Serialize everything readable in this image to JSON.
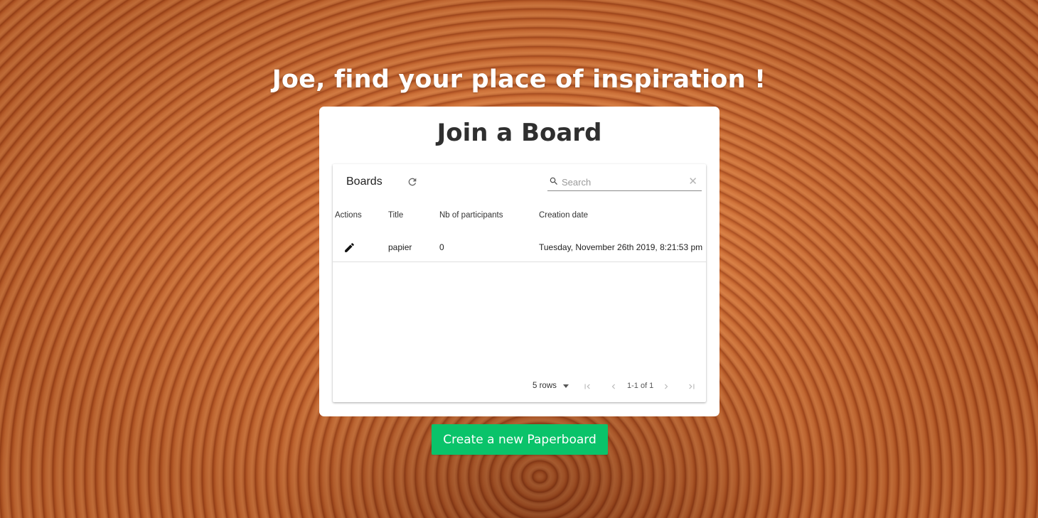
{
  "headline": "Joe, find your place of inspiration !",
  "card": {
    "title": "Join a Board"
  },
  "table": {
    "toolbar_title": "Boards",
    "search_placeholder": "Search",
    "columns": [
      "Actions",
      "Title",
      "Nb of participants",
      "Creation date"
    ],
    "rows": [
      {
        "title": "papier",
        "participants": "0",
        "creation_date": "Tuesday, November 26th 2019, 8:21:53 pm"
      }
    ],
    "footer": {
      "rows_per_page": "5 rows",
      "page_info": "1-1 of 1"
    }
  },
  "cta_label": "Create a new Paperboard",
  "colors": {
    "cta": "#0ac36a",
    "background": "#c8652c"
  },
  "icons": {
    "refresh": "refresh-icon",
    "search": "search-icon",
    "clear": "clear-icon",
    "edit": "pencil-icon",
    "first_page": "first-page-icon",
    "prev_page": "chevron-left-icon",
    "next_page": "chevron-right-icon",
    "last_page": "last-page-icon"
  }
}
